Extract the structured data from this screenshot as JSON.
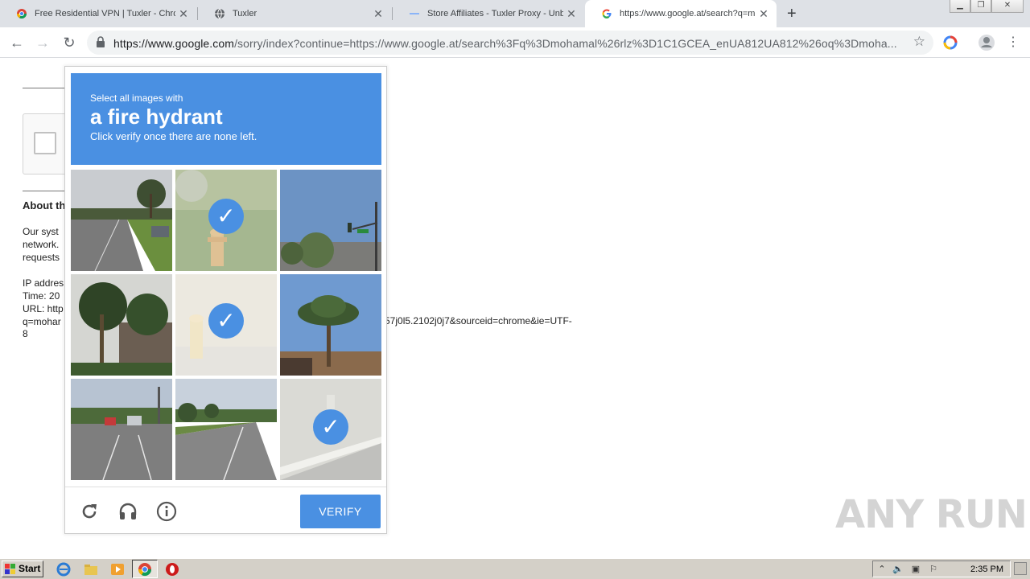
{
  "browser": {
    "tabs": [
      {
        "title": "Free Residential VPN | Tuxler - Chrome",
        "icon": "chrome-webstore-icon",
        "active": false
      },
      {
        "title": "Tuxler",
        "icon": "globe-icon",
        "active": false
      },
      {
        "title": "Store Affiliates - Tuxler Proxy - Unblock",
        "icon": "store-icon",
        "active": false
      },
      {
        "title": "https://www.google.at/search?q=moh",
        "icon": "google-icon",
        "active": true
      }
    ],
    "new_tab_label": "+",
    "url_host": "https://www.google.com",
    "url_path": "/sorry/index?continue=https://www.google.at/search%3Fq%3Dmohamal%26rlz%3D1C1GCEA_enUA812UA812%26oq%3Dmoha..."
  },
  "page": {
    "about_heading": "About th",
    "body_lines": [
      "Our syst",
      "network.",
      "requests"
    ],
    "info_lines": [
      "IP addres",
      "Time: 20",
      "URL: http",
      "q=mohar"
    ],
    "url_tail": "57j0l5.2102j0j7&sourceid=chrome&ie=UTF-",
    "url_tail2": "8"
  },
  "captcha": {
    "instruction_small": "Select all images with",
    "target": "a fire hydrant",
    "instruction_sub": "Click verify once there are none left.",
    "tiles": [
      {
        "scene": "street-road",
        "selected": false
      },
      {
        "scene": "fire-hydrant-grass",
        "selected": true
      },
      {
        "scene": "traffic-light-sky",
        "selected": false
      },
      {
        "scene": "palm-trees-house",
        "selected": false
      },
      {
        "scene": "fire-hydrant-faded",
        "selected": true
      },
      {
        "scene": "palm-tree-sunset",
        "selected": false
      },
      {
        "scene": "street-cars",
        "selected": false
      },
      {
        "scene": "street-road-2",
        "selected": false
      },
      {
        "scene": "sidewalk-curb",
        "selected": true
      }
    ],
    "verify_label": "VERIFY",
    "colors": {
      "accent": "#4a90e2"
    }
  },
  "watermark": "ANY RUN",
  "taskbar": {
    "start_label": "Start",
    "clock": "2:35 PM"
  }
}
